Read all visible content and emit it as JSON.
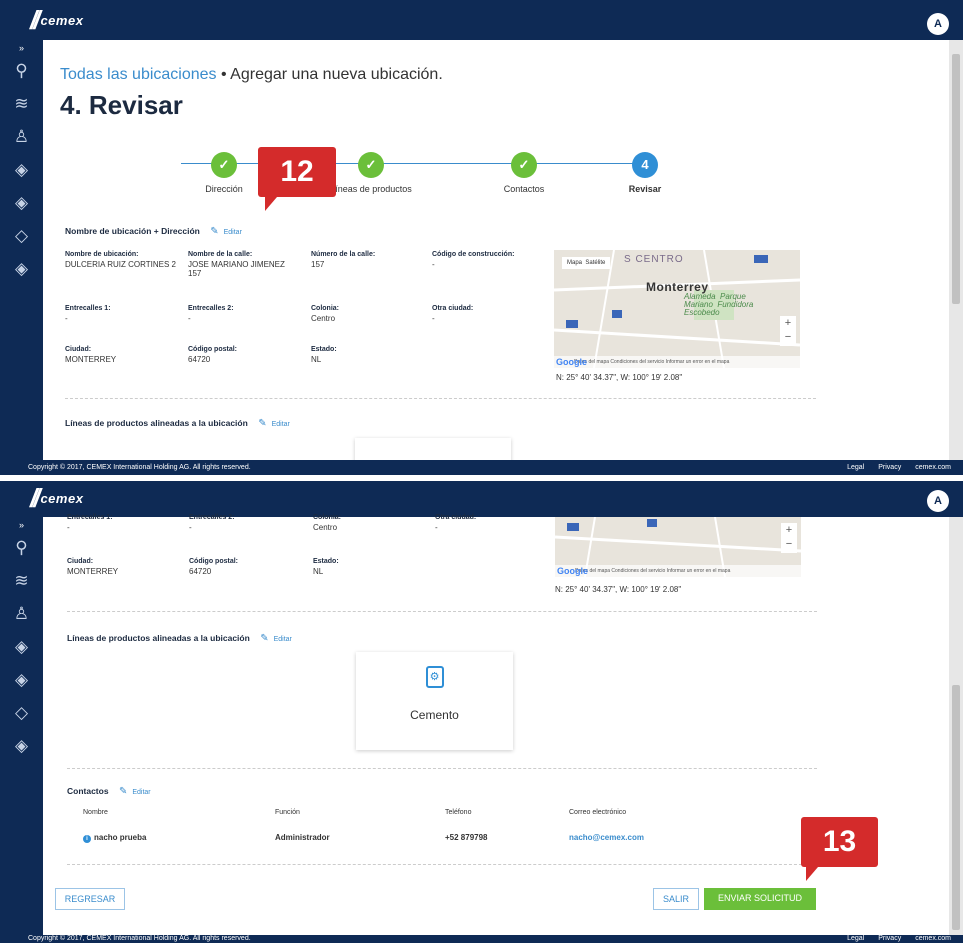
{
  "brand": {
    "logo_text": "cemex",
    "logo_slashes": "//"
  },
  "user": {
    "avatar_initial": "A"
  },
  "footer": {
    "copyright": "Copyright © 2017, CEMEX International Holding AG. All rights reserved.",
    "links": [
      "Legal",
      "Privacy",
      "cemex.com"
    ]
  },
  "sidebar": {
    "toggle": "»",
    "icons": [
      "location-icon",
      "layers-icon",
      "user-icon",
      "tag-icon",
      "layers-alt-icon",
      "tag-alt-icon",
      "tag-outline-icon"
    ]
  },
  "breadcrumb": {
    "link": "Todas las ubicaciones",
    "separator": "•",
    "current": "Agregar una nueva ubicación."
  },
  "page_title": "4. Revisar",
  "steps": [
    {
      "label": "Dirección",
      "mark": "✓",
      "state": "done"
    },
    {
      "label": "Líneas de productos",
      "mark": "✓",
      "state": "done"
    },
    {
      "label": "Contactos",
      "mark": "✓",
      "state": "done"
    },
    {
      "label": "Revisar",
      "mark": "4",
      "state": "active"
    }
  ],
  "address_section": {
    "title": "Nombre de ubicación + Dirección",
    "edit": "Editar",
    "fields": {
      "name": {
        "label": "Nombre de ubicación:",
        "value": "DULCERIA RUIZ CORTINES 2"
      },
      "street": {
        "label": "Nombre de la calle:",
        "value": "JOSE MARIANO JIMENEZ",
        "value2": "157"
      },
      "number": {
        "label": "Número de la calle:",
        "value": "157"
      },
      "code": {
        "label": "Código de construcción:",
        "value": "-"
      },
      "between1": {
        "label": "Entrecalles 1:",
        "value": "-"
      },
      "between2": {
        "label": "Entrecalles 2:",
        "value": "-"
      },
      "colonia": {
        "label": "Colonia:",
        "value": "Centro"
      },
      "other_city": {
        "label": "Otra ciudad:",
        "value": "-"
      },
      "city": {
        "label": "Ciudad:",
        "value": "MONTERREY"
      },
      "postal": {
        "label": "Código postal:",
        "value": "64720"
      },
      "state": {
        "label": "Estado:",
        "value": "NL"
      }
    }
  },
  "map": {
    "type_buttons": [
      "Mapa",
      "Satélite"
    ],
    "area_label": "S CENTRO",
    "city_label": "Monterrey",
    "park_label": "Alameda  Parque\nMariano  Fundidora\nEscobedo",
    "zoom_in": "+",
    "zoom_out": "−",
    "footer": "Datos del mapa   Condiciones del servicio   Informar un error en el mapa",
    "google": "Google",
    "coordinates": "N: 25° 40' 34.37\", W: 100° 19' 2.08\""
  },
  "products_section": {
    "title": "Líneas de productos alineadas a la ubicación",
    "edit": "Editar",
    "product": "Cemento"
  },
  "contacts_section": {
    "title": "Contactos",
    "edit": "Editar",
    "headers": [
      "Nombre",
      "Función",
      "Teléfono",
      "Correo electrónico"
    ],
    "row": {
      "name": "nacho prueba",
      "role": "Administrador",
      "phone": "+52 879798",
      "email": "nacho@cemex.com"
    }
  },
  "actions": {
    "back": "REGRESAR",
    "exit": "SALIR",
    "submit": "ENVIAR SOLICITUD"
  },
  "callouts": {
    "first": "12",
    "second": "13"
  },
  "colors": {
    "navy": "#0e2a55",
    "accent_blue": "#2f8fd6",
    "success_green": "#6bbf3a",
    "callout_red": "#d42b2b"
  }
}
